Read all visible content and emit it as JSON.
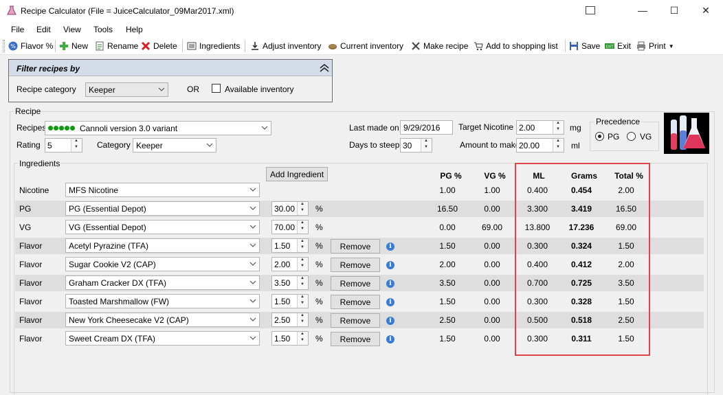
{
  "window": {
    "title": "Recipe Calculator (File = JuiceCalculator_09Mar2017.xml)",
    "minimize_glyph": "—",
    "maximize_glyph": "☐",
    "close_glyph": "✕"
  },
  "menu": [
    "File",
    "Edit",
    "View",
    "Tools",
    "Help"
  ],
  "toolbar": {
    "flavor_pct": "Flavor %",
    "new": "New",
    "rename": "Rename",
    "delete": "Delete",
    "ingredients": "Ingredients",
    "adjust_inventory": "Adjust inventory",
    "current_inventory": "Current inventory",
    "make_recipe": "Make recipe",
    "add_to_shopping_list": "Add to shopping list",
    "save": "Save",
    "exit": "Exit",
    "print": "Print"
  },
  "filter": {
    "title": "Filter recipes by",
    "category_label": "Recipe category",
    "category_value": "Keeper",
    "or_label": "OR",
    "available_inventory_label": "Available inventory"
  },
  "recipe": {
    "group_label": "Recipe",
    "recipes_label": "Recipes",
    "recipe_name": "Cannoli version 3.0 variant",
    "rating_label": "Rating",
    "rating_value": "5",
    "category_label": "Category",
    "category_value": "Keeper",
    "last_made_label": "Last made on",
    "last_made_value": "9/29/2016",
    "days_to_steep_label": "Days to steep",
    "days_to_steep_value": "30",
    "target_nicotine_label": "Target Nicotine",
    "target_nicotine_value": "2.00",
    "target_nicotine_unit": "mg",
    "amount_label": "Amount to make",
    "amount_value": "20.00",
    "amount_unit": "ml",
    "precedence_label": "Precedence",
    "pg_label": "PG",
    "vg_label": "VG",
    "precedence_selected": "PG"
  },
  "ingredients": {
    "group_label": "Ingredients",
    "add_button": "Add Ingredient",
    "remove_label": "Remove",
    "pct_sign": "%",
    "info_glyph": "i",
    "headers": {
      "pg": "PG %",
      "vg": "VG %",
      "ml": "ML",
      "grams": "Grams",
      "total": "Total %"
    },
    "rows": [
      {
        "type": "Nicotine",
        "name": "MFS Nicotine",
        "percent": "",
        "pg": "1.00",
        "vg": "1.00",
        "ml": "0.400",
        "grams": "0.454",
        "total": "2.00",
        "removable": false
      },
      {
        "type": "PG",
        "name": "PG (Essential Depot)",
        "percent": "30.00",
        "pg": "16.50",
        "vg": "0.00",
        "ml": "3.300",
        "grams": "3.419",
        "total": "16.50",
        "removable": false
      },
      {
        "type": "VG",
        "name": "VG (Essential Depot)",
        "percent": "70.00",
        "pg": "0.00",
        "vg": "69.00",
        "ml": "13.800",
        "grams": "17.236",
        "total": "69.00",
        "removable": false
      },
      {
        "type": "Flavor",
        "name": "Acetyl Pyrazine (TFA)",
        "percent": "1.50",
        "pg": "1.50",
        "vg": "0.00",
        "ml": "0.300",
        "grams": "0.324",
        "total": "1.50",
        "removable": true
      },
      {
        "type": "Flavor",
        "name": "Sugar Cookie V2 (CAP)",
        "percent": "2.00",
        "pg": "2.00",
        "vg": "0.00",
        "ml": "0.400",
        "grams": "0.412",
        "total": "2.00",
        "removable": true
      },
      {
        "type": "Flavor",
        "name": "Graham Cracker DX (TFA)",
        "percent": "3.50",
        "pg": "3.50",
        "vg": "0.00",
        "ml": "0.700",
        "grams": "0.725",
        "total": "3.50",
        "removable": true
      },
      {
        "type": "Flavor",
        "name": "Toasted Marshmallow (FW)",
        "percent": "1.50",
        "pg": "1.50",
        "vg": "0.00",
        "ml": "0.300",
        "grams": "0.328",
        "total": "1.50",
        "removable": true
      },
      {
        "type": "Flavor",
        "name": "New York Cheesecake V2 (CAP)",
        "percent": "2.50",
        "pg": "2.50",
        "vg": "0.00",
        "ml": "0.500",
        "grams": "0.518",
        "total": "2.50",
        "removable": true
      },
      {
        "type": "Flavor",
        "name": "Sweet Cream DX (TFA)",
        "percent": "1.50",
        "pg": "1.50",
        "vg": "0.00",
        "ml": "0.300",
        "grams": "0.311",
        "total": "1.50",
        "removable": true
      }
    ]
  },
  "colors": {
    "highlight_border": "#e0444a",
    "rating_dots": "#0d9a0d",
    "filter_header": "#d4dbe9",
    "row_shade": "#dedede"
  }
}
